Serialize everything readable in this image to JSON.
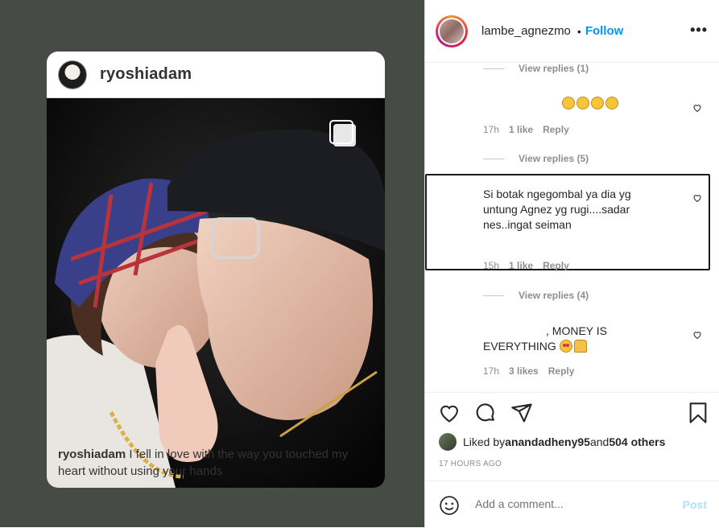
{
  "card": {
    "username": "ryoshiadam",
    "caption_user": "ryoshiadam",
    "caption_text": " I fell in love with the way you touched my heart without using your hands"
  },
  "post_header": {
    "username": "lambe_agnezmo",
    "dot": "•",
    "follow": "Follow",
    "more": "•••"
  },
  "comments": [
    {
      "view_replies": "View replies (1)"
    },
    {
      "text": "",
      "time": "17h",
      "likes": "1 like",
      "reply": "Reply"
    },
    {
      "view_replies": "View replies (5)"
    },
    {
      "text": "Si botak ngegombal ya dia yg untung Agnez yg rugi....sadar nes..ingat seiman",
      "time": "15h",
      "likes": "1 like",
      "reply": "Reply"
    },
    {
      "view_replies": "View replies (4)"
    },
    {
      "text_a": ", MONEY IS",
      "text_b": "EVERYTHING",
      "time": "17h",
      "likes": "3 likes",
      "reply": "Reply"
    }
  ],
  "likes": {
    "prefix": "Liked by ",
    "user": "anandadheny95",
    "and": " and ",
    "others": "504 others"
  },
  "timestamp": "17 HOURS AGO",
  "add_comment": {
    "placeholder": "Add a comment...",
    "post": "Post"
  },
  "colors": {
    "follow": "#0095f6",
    "post_disabled": "#b2dffc",
    "left_bg": "#464b45"
  }
}
